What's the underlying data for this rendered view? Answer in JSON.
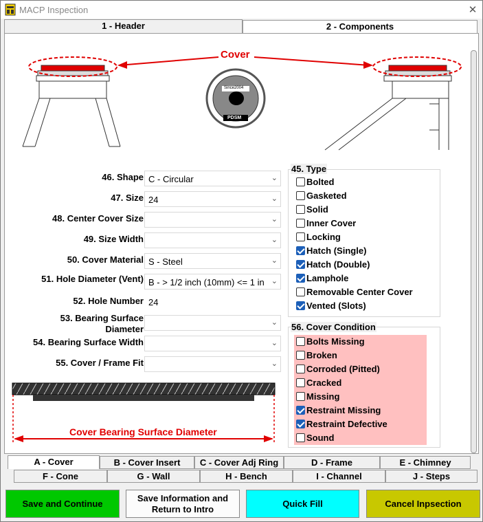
{
  "window": {
    "title": "MACP Inspection",
    "close": "✕",
    "app_icon_text": "MACP"
  },
  "top_tabs": [
    {
      "label": "1 - Header"
    },
    {
      "label": "2 - Components"
    }
  ],
  "diagram": {
    "label": "Cover",
    "logo_top": "Since2004",
    "logo_bottom": "PDSM"
  },
  "fields": [
    {
      "label": "46. Shape",
      "value": "C - Circular"
    },
    {
      "label": "47. Size",
      "value": "24"
    },
    {
      "label": "48. Center Cover Size",
      "value": ""
    },
    {
      "label": "49. Size Width",
      "value": ""
    },
    {
      "label": "50. Cover Material",
      "value": "S - Steel"
    },
    {
      "label": "51. Hole Diameter (Vent)",
      "value": "B - > 1/2 inch (10mm) <= 1 in"
    },
    {
      "label": "52. Hole Number",
      "value": "24"
    },
    {
      "label": "53. Bearing Surface",
      "label2": "Diameter",
      "value": ""
    },
    {
      "label": "54. Bearing Surface Width",
      "value": ""
    },
    {
      "label": "55. Cover / Frame Fit",
      "value": ""
    }
  ],
  "type_group": {
    "title": "45. Type",
    "items": [
      {
        "label": "Bolted",
        "checked": false
      },
      {
        "label": "Gasketed",
        "checked": false
      },
      {
        "label": "Solid",
        "checked": false
      },
      {
        "label": "Inner Cover",
        "checked": false
      },
      {
        "label": "Locking",
        "checked": false
      },
      {
        "label": "Hatch (Single)",
        "checked": true
      },
      {
        "label": "Hatch (Double)",
        "checked": true
      },
      {
        "label": "Lamphole",
        "checked": true
      },
      {
        "label": "Removable Center Cover",
        "checked": false
      },
      {
        "label": "Vented (Slots)",
        "checked": true
      }
    ]
  },
  "condition_group": {
    "title": "56. Cover Condition",
    "items": [
      {
        "label": "Bolts Missing",
        "checked": false
      },
      {
        "label": "Broken",
        "checked": false
      },
      {
        "label": "Corroded (Pitted)",
        "checked": false
      },
      {
        "label": "Cracked",
        "checked": false
      },
      {
        "label": "Missing",
        "checked": false
      },
      {
        "label": "Restraint Missing",
        "checked": true
      },
      {
        "label": "Restraint Defective",
        "checked": true
      },
      {
        "label": "Sound",
        "checked": false
      }
    ]
  },
  "bearing_diagram": {
    "label": "Cover Bearing Surface Diameter"
  },
  "bottom_tabs_row1": [
    {
      "label": "A - Cover"
    },
    {
      "label": "B - Cover Insert"
    },
    {
      "label": "C - Cover Adj Ring"
    },
    {
      "label": "D - Frame"
    },
    {
      "label": "E - Chimney"
    }
  ],
  "bottom_tabs_row2": [
    {
      "label": "F - Cone"
    },
    {
      "label": "G - Wall"
    },
    {
      "label": "H - Bench"
    },
    {
      "label": "I - Channel"
    },
    {
      "label": "J - Steps"
    }
  ],
  "buttons": {
    "save_continue": "Save and Continue",
    "save_return_1": "Save Information and",
    "save_return_2": "Return to Intro",
    "quick_fill": "Quick Fill",
    "cancel": "Cancel Inpsection"
  },
  "colors": {
    "save": "#00c800",
    "quickfill": "#00ffff",
    "cancel": "#c8c800",
    "accent_red": "#e00000",
    "checked": "#1c5fb8"
  }
}
